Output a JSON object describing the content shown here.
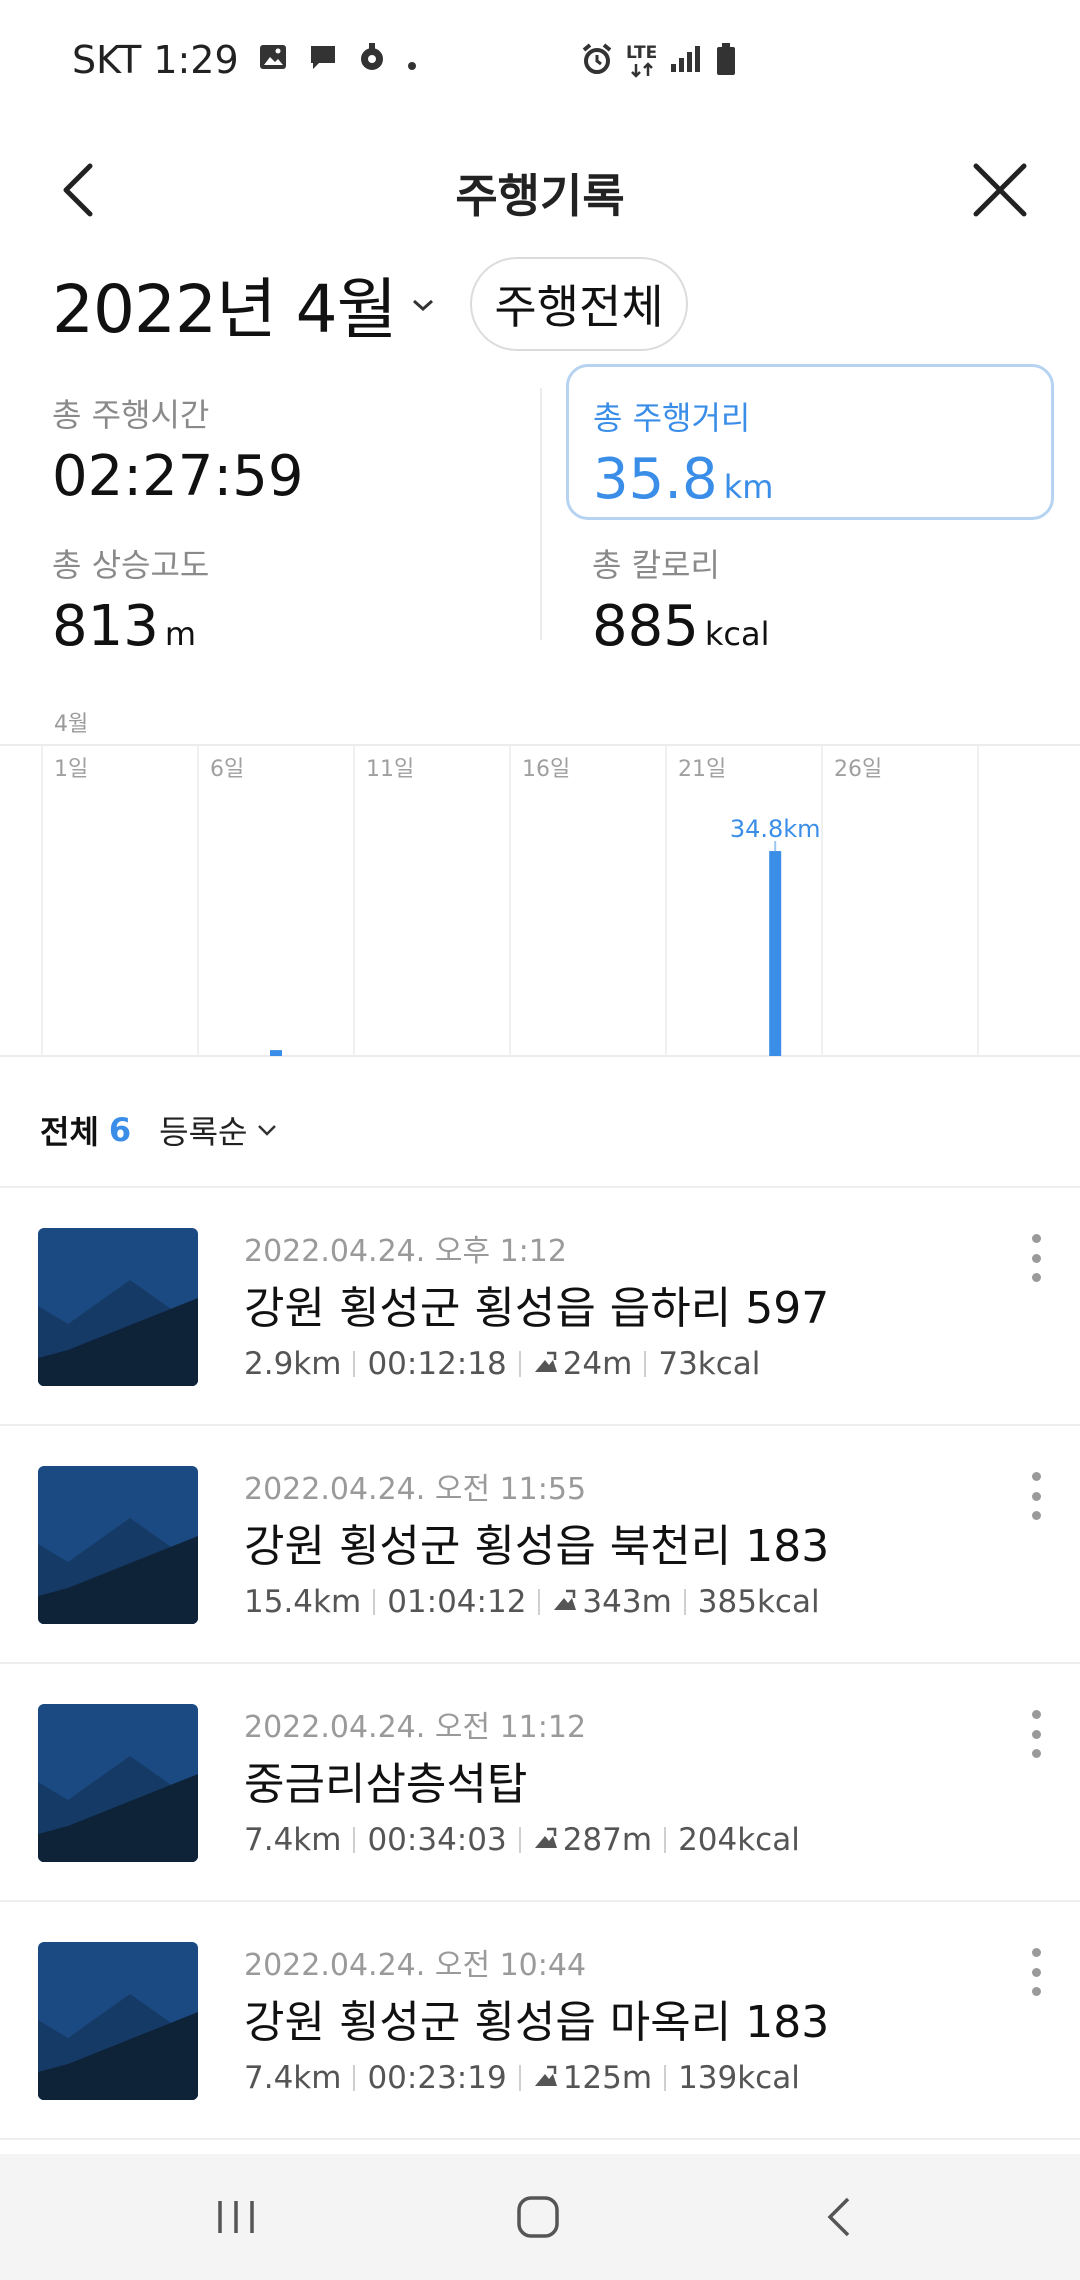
{
  "status_bar": {
    "carrier": "SKT",
    "time": "1:29",
    "left_icons": [
      "gallery-icon",
      "message-icon",
      "location-icon",
      "dot-icon"
    ],
    "right_icons": [
      "alarm-icon",
      "lte-icon",
      "signal-icon",
      "battery-icon"
    ],
    "lte_text": "LTE"
  },
  "header": {
    "title": "주행기록"
  },
  "period": {
    "month_label": "2022년 4월",
    "filter_label": "주행전체"
  },
  "summary": {
    "time_label": "총 주행시간",
    "time_value": "02:27:59",
    "distance_label": "총 주행거리",
    "distance_value": "35.8",
    "distance_unit": "km",
    "elevation_label": "총 상승고도",
    "elevation_value": "813",
    "elevation_unit": "m",
    "calorie_label": "총 칼로리",
    "calorie_value": "885",
    "calorie_unit": "kcal"
  },
  "chart_data": {
    "type": "bar",
    "month_label": "4월",
    "tick_labels": [
      "1일",
      "6일",
      "11일",
      "16일",
      "21일",
      "26일"
    ],
    "x": [
      8,
      24
    ],
    "values": [
      1.0,
      34.8
    ],
    "unit": "km",
    "data_labels": [
      "",
      "34.8km"
    ],
    "ylim": [
      0,
      36
    ],
    "xlim": [
      1,
      31
    ],
    "grid": true,
    "color": "#3a8ee8"
  },
  "list": {
    "total_label": "전체",
    "total_count": "6",
    "sort_label": "등록순",
    "items": [
      {
        "date": "2022.04.24. 오후 1:12",
        "name": "강원 횡성군 횡성읍 읍하리 597",
        "distance": "2.9km",
        "duration": "00:12:18",
        "elevation": "24m",
        "calories": "73kcal"
      },
      {
        "date": "2022.04.24. 오전 11:55",
        "name": "강원 횡성군 횡성읍 북천리 183",
        "distance": "15.4km",
        "duration": "01:04:12",
        "elevation": "343m",
        "calories": "385kcal"
      },
      {
        "date": "2022.04.24. 오전 11:12",
        "name": "중금리삼층석탑",
        "distance": "7.4km",
        "duration": "00:34:03",
        "elevation": "287m",
        "calories": "204kcal"
      },
      {
        "date": "2022.04.24. 오전 10:44",
        "name": "강원 횡성군 횡성읍 마옥리 183",
        "distance": "7.4km",
        "duration": "00:23:19",
        "elevation": "125m",
        "calories": "139kcal"
      }
    ]
  },
  "colors": {
    "accent": "#3a8ee8",
    "thumb_sky": "#1b4a82",
    "thumb_mountain": "#0e2238"
  }
}
